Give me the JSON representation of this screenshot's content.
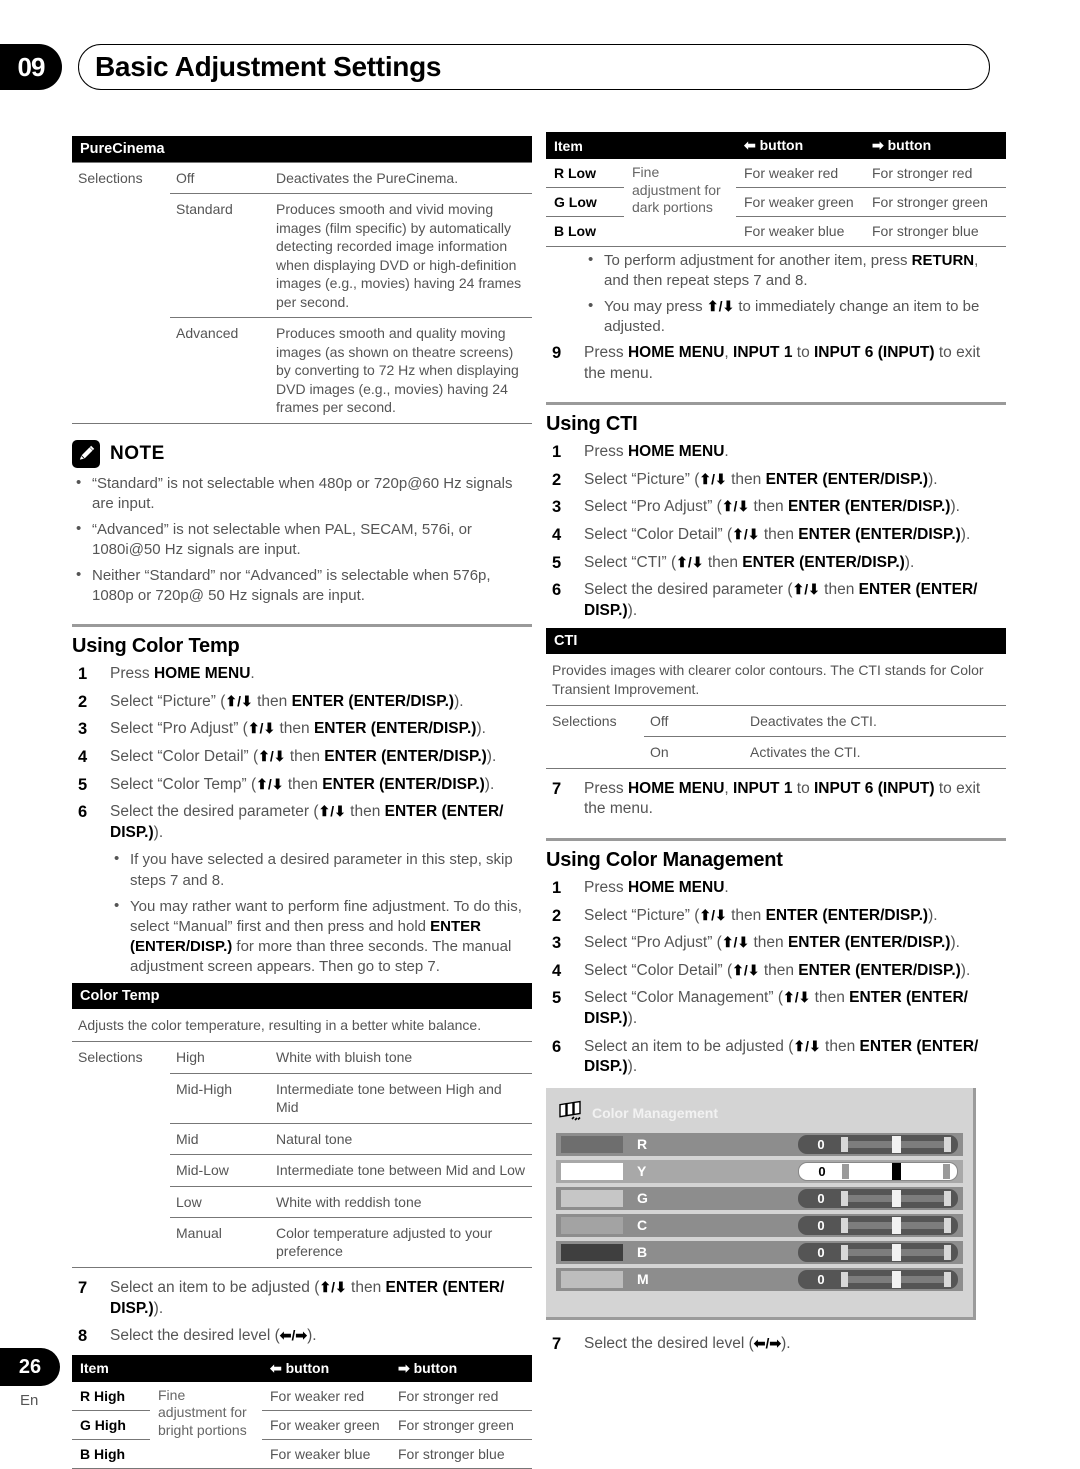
{
  "header": {
    "chapter_number": "09",
    "chapter_title": "Basic Adjustment Settings"
  },
  "footer": {
    "page_number": "26",
    "language": "En"
  },
  "purecinema": {
    "title": "PureCinema",
    "selections_label": "Selections",
    "rows": [
      {
        "name": "Off",
        "desc": "Deactivates the PureCinema."
      },
      {
        "name": "Standard",
        "desc": "Produces smooth and vivid moving images (film specific) by automatically detecting recorded image information when displaying DVD or high-definition images (e.g., movies) having 24 frames per second."
      },
      {
        "name": "Advanced",
        "desc": "Produces smooth and quality moving images (as shown on theatre screens) by converting to 72 Hz when displaying DVD images (e.g., movies) having 24 frames per second."
      }
    ]
  },
  "note": {
    "icon": "pencil-icon",
    "label": "NOTE",
    "items": [
      "“Standard” is not selectable when 480p or 720p@60 Hz signals are input.",
      "“Advanced” is not selectable when PAL, SECAM, 576i, or 1080i@50 Hz signals are input.",
      "Neither “Standard” nor “Advanced” is selectable when 576p, 1080p or 720p@ 50 Hz signals are input."
    ]
  },
  "color_temp_section": {
    "title": "Using Color Temp",
    "steps": [
      {
        "num": "1",
        "parts": [
          {
            "t": "Press "
          },
          {
            "b": "HOME MENU"
          },
          {
            "t": "."
          }
        ]
      },
      {
        "num": "2",
        "parts": [
          {
            "t": "Select “Picture” ("
          },
          {
            "a": "⬆/⬇"
          },
          {
            "t": " then "
          },
          {
            "b": "ENTER (ENTER/DISP.)"
          },
          {
            "t": ")."
          }
        ]
      },
      {
        "num": "3",
        "parts": [
          {
            "t": "Select “Pro Adjust” ("
          },
          {
            "a": "⬆/⬇"
          },
          {
            "t": " then "
          },
          {
            "b": "ENTER (ENTER/DISP.)"
          },
          {
            "t": ")."
          }
        ]
      },
      {
        "num": "4",
        "parts": [
          {
            "t": "Select “Color Detail” ("
          },
          {
            "a": "⬆/⬇"
          },
          {
            "t": " then "
          },
          {
            "b": "ENTER (ENTER/DISP.)"
          },
          {
            "t": ")."
          }
        ]
      },
      {
        "num": "5",
        "parts": [
          {
            "t": "Select “Color Temp” ("
          },
          {
            "a": "⬆/⬇"
          },
          {
            "t": " then "
          },
          {
            "b": "ENTER (ENTER/DISP.)"
          },
          {
            "t": ")."
          }
        ]
      },
      {
        "num": "6",
        "parts": [
          {
            "t": "Select the desired parameter ("
          },
          {
            "a": "⬆/⬇"
          },
          {
            "t": " then "
          },
          {
            "b": "ENTER (ENTER/ DISP.)"
          },
          {
            "t": ")."
          }
        ]
      }
    ],
    "bullets": [
      [
        {
          "t": "If you have selected a desired parameter in this step, skip steps 7 and 8."
        }
      ],
      [
        {
          "t": "You may rather want to perform fine adjustment. To do this, select “Manual” first and then press and hold "
        },
        {
          "b": "ENTER (ENTER/DISP.)"
        },
        {
          "t": " for more than three seconds. The manual adjustment screen appears. Then go to step 7."
        }
      ]
    ],
    "steps_tail": [
      {
        "num": "7",
        "parts": [
          {
            "t": "Select an item to be adjusted ("
          },
          {
            "a": "⬆/⬇"
          },
          {
            "t": " then "
          },
          {
            "b": "ENTER (ENTER/ DISP.)"
          },
          {
            "t": ")."
          }
        ]
      },
      {
        "num": "8",
        "parts": [
          {
            "t": "Select the desired level ("
          },
          {
            "a": "⬅/➡"
          },
          {
            "t": ")."
          }
        ]
      }
    ]
  },
  "color_temp_table": {
    "title": "Color Temp",
    "description": "Adjusts the color temperature, resulting in a better white balance.",
    "selections_label": "Selections",
    "rows": [
      {
        "name": "High",
        "desc": "White with bluish tone"
      },
      {
        "name": "Mid-High",
        "desc": "Intermediate tone between High and Mid"
      },
      {
        "name": "Mid",
        "desc": "Natural tone"
      },
      {
        "name": "Mid-Low",
        "desc": "Intermediate tone between Mid and Low"
      },
      {
        "name": "Low",
        "desc": "White with reddish tone"
      },
      {
        "name": "Manual",
        "desc": "Color temperature adjusted to your preference"
      }
    ]
  },
  "high_table": {
    "headers": {
      "item": "Item",
      "left_button": "button",
      "right_button": "button",
      "left_icon": "left-arrow-icon",
      "right_icon": "right-arrow-icon"
    },
    "fine_text": "Fine adjustment for bright portions",
    "rows": [
      {
        "item": "R High",
        "weaker": "For weaker red",
        "stronger": "For stronger red"
      },
      {
        "item": "G High",
        "weaker": "For weaker green",
        "stronger": "For stronger green"
      },
      {
        "item": "B High",
        "weaker": "For weaker blue",
        "stronger": "For stronger blue"
      }
    ]
  },
  "low_table": {
    "headers": {
      "item": "Item",
      "left_button": "button",
      "right_button": "button",
      "left_icon": "left-arrow-icon",
      "right_icon": "right-arrow-icon"
    },
    "fine_text": "Fine adjustment for dark portions",
    "rows": [
      {
        "item": "R Low",
        "weaker": "For weaker red",
        "stronger": "For stronger red"
      },
      {
        "item": "G Low",
        "weaker": "For weaker green",
        "stronger": "For stronger green"
      },
      {
        "item": "B Low",
        "weaker": "For weaker blue",
        "stronger": "For stronger blue"
      }
    ]
  },
  "low_table_notes": {
    "bullets": [
      [
        {
          "t": "To perform adjustment for another item, press "
        },
        {
          "b": "RETURN"
        },
        {
          "t": ", and then repeat steps 7 and 8."
        }
      ],
      [
        {
          "t": "You may press "
        },
        {
          "a": "⬆/⬇"
        },
        {
          "t": " to immediately change an item to be adjusted."
        }
      ]
    ],
    "step": {
      "num": "9",
      "parts": [
        {
          "t": "Press "
        },
        {
          "b": "HOME MENU"
        },
        {
          "t": ", "
        },
        {
          "b": "INPUT 1"
        },
        {
          "t": " to "
        },
        {
          "b": "INPUT 6 (INPUT)"
        },
        {
          "t": " to exit the menu."
        }
      ]
    }
  },
  "cti_section": {
    "title": "Using CTI",
    "steps": [
      {
        "num": "1",
        "parts": [
          {
            "t": "Press "
          },
          {
            "b": "HOME MENU"
          },
          {
            "t": "."
          }
        ]
      },
      {
        "num": "2",
        "parts": [
          {
            "t": "Select “Picture” ("
          },
          {
            "a": "⬆/⬇"
          },
          {
            "t": " then "
          },
          {
            "b": "ENTER (ENTER/DISP.)"
          },
          {
            "t": ")."
          }
        ]
      },
      {
        "num": "3",
        "parts": [
          {
            "t": "Select “Pro Adjust” ("
          },
          {
            "a": "⬆/⬇"
          },
          {
            "t": " then "
          },
          {
            "b": "ENTER (ENTER/DISP.)"
          },
          {
            "t": ")."
          }
        ]
      },
      {
        "num": "4",
        "parts": [
          {
            "t": "Select “Color Detail” ("
          },
          {
            "a": "⬆/⬇"
          },
          {
            "t": " then "
          },
          {
            "b": "ENTER (ENTER/DISP.)"
          },
          {
            "t": ")."
          }
        ]
      },
      {
        "num": "5",
        "parts": [
          {
            "t": "Select “CTI” ("
          },
          {
            "a": "⬆/⬇"
          },
          {
            "t": " then "
          },
          {
            "b": "ENTER (ENTER/DISP.)"
          },
          {
            "t": ")."
          }
        ]
      },
      {
        "num": "6",
        "parts": [
          {
            "t": "Select the desired parameter ("
          },
          {
            "a": "⬆/⬇"
          },
          {
            "t": " then "
          },
          {
            "b": "ENTER (ENTER/ DISP.)"
          },
          {
            "t": ")."
          }
        ]
      }
    ],
    "step_tail": {
      "num": "7",
      "parts": [
        {
          "t": "Press "
        },
        {
          "b": "HOME MENU"
        },
        {
          "t": ", "
        },
        {
          "b": "INPUT 1"
        },
        {
          "t": " to "
        },
        {
          "b": "INPUT 6 (INPUT)"
        },
        {
          "t": " to exit the menu."
        }
      ]
    }
  },
  "cti_table": {
    "title": "CTI",
    "description": "Provides images with clearer color contours. The CTI stands for Color Transient Improvement.",
    "selections_label": "Selections",
    "rows": [
      {
        "name": "Off",
        "desc": "Deactivates the CTI."
      },
      {
        "name": "On",
        "desc": "Activates the CTI."
      }
    ]
  },
  "color_management_section": {
    "title": "Using Color Management",
    "steps": [
      {
        "num": "1",
        "parts": [
          {
            "t": "Press "
          },
          {
            "b": "HOME MENU"
          },
          {
            "t": "."
          }
        ]
      },
      {
        "num": "2",
        "parts": [
          {
            "t": "Select “Picture” ("
          },
          {
            "a": "⬆/⬇"
          },
          {
            "t": " then "
          },
          {
            "b": "ENTER (ENTER/DISP.)"
          },
          {
            "t": ")."
          }
        ]
      },
      {
        "num": "3",
        "parts": [
          {
            "t": "Select “Pro Adjust” ("
          },
          {
            "a": "⬆/⬇"
          },
          {
            "t": " then "
          },
          {
            "b": "ENTER (ENTER/DISP.)"
          },
          {
            "t": ")."
          }
        ]
      },
      {
        "num": "4",
        "parts": [
          {
            "t": "Select “Color Detail” ("
          },
          {
            "a": "⬆/⬇"
          },
          {
            "t": " then "
          },
          {
            "b": "ENTER (ENTER/DISP.)"
          },
          {
            "t": ")."
          }
        ]
      },
      {
        "num": "5",
        "parts": [
          {
            "t": "Select “Color Management” ("
          },
          {
            "a": "⬆/⬇"
          },
          {
            "t": " then "
          },
          {
            "b": "ENTER (ENTER/ DISP.)"
          },
          {
            "t": ")."
          }
        ]
      },
      {
        "num": "6",
        "parts": [
          {
            "t": "Select an item to be adjusted ("
          },
          {
            "a": "⬆/⬇"
          },
          {
            "t": " then "
          },
          {
            "b": "ENTER (ENTER/ DISP.)"
          },
          {
            "t": ")."
          }
        ]
      }
    ],
    "step_tail": {
      "num": "7",
      "parts": [
        {
          "t": "Select the desired level ("
        },
        {
          "a": "⬅/➡"
        },
        {
          "t": ")."
        }
      ]
    }
  },
  "osd": {
    "icon": "color-management-icon",
    "title": "Color Management",
    "rows": [
      {
        "label": "R",
        "value": "0",
        "swatch": "#6e6e6e",
        "selected": false
      },
      {
        "label": "Y",
        "value": "0",
        "swatch": "#ffffff",
        "selected": true
      },
      {
        "label": "G",
        "value": "0",
        "swatch": "#c6c6c6",
        "selected": false
      },
      {
        "label": "C",
        "value": "0",
        "swatch": "#a3a3a3",
        "selected": false
      },
      {
        "label": "B",
        "value": "0",
        "swatch": "#3f3f3f",
        "selected": false
      },
      {
        "label": "M",
        "value": "0",
        "swatch": "#bdbdbd",
        "selected": false
      }
    ]
  }
}
